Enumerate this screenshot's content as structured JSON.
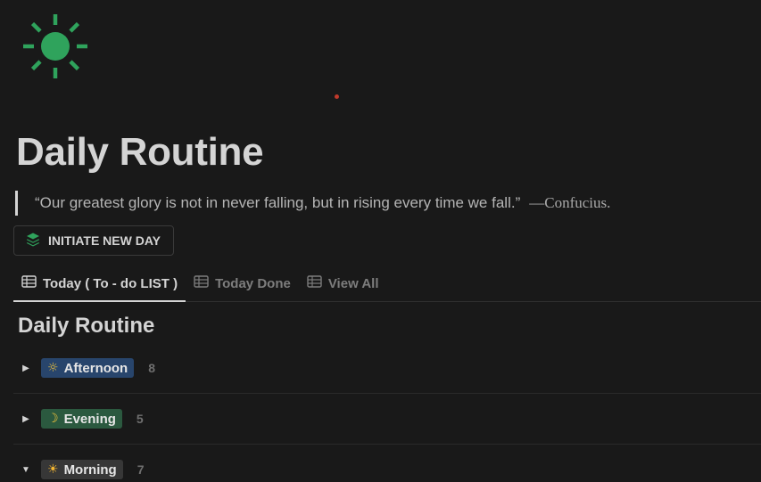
{
  "page": {
    "icon": "sun-icon",
    "title": "Daily Routine",
    "accent_color": "#2fa35c"
  },
  "quote": {
    "text": "“Our greatest glory is not in never falling, but in rising every time we fall.”",
    "author": "—Confucius."
  },
  "action_button": {
    "label": "INITIATE NEW DAY",
    "icon": "layers-icon"
  },
  "tabs": [
    {
      "label": "Today ( To - do LIST )",
      "icon": "table-icon",
      "active": true
    },
    {
      "label": "Today Done",
      "icon": "table-icon",
      "active": false
    },
    {
      "label": "View All",
      "icon": "table-icon",
      "active": false
    }
  ],
  "view": {
    "title": "Daily Routine"
  },
  "groups": [
    {
      "emoji": "☼",
      "name": "Afternoon",
      "count": "8",
      "expanded": false,
      "color": "#28456c"
    },
    {
      "emoji": "☽",
      "name": "Evening",
      "count": "5",
      "expanded": false,
      "color": "#2b593f"
    },
    {
      "emoji": "☀",
      "name": "Morning",
      "count": "7",
      "expanded": true,
      "color": "#373737"
    }
  ]
}
